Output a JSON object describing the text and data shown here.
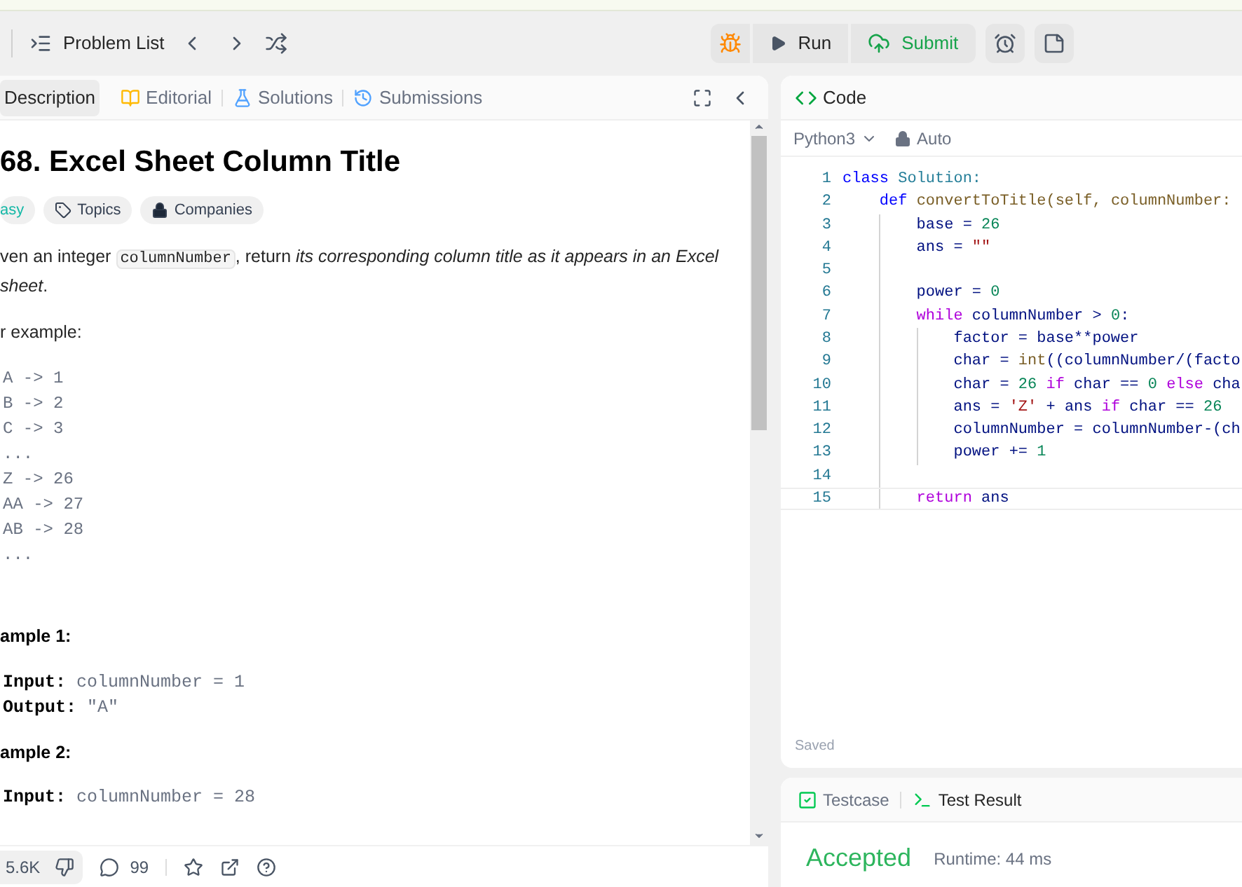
{
  "top_bar": {
    "problem_list": "Problem List",
    "run": "Run",
    "submit": "Submit"
  },
  "description_tabs": [
    {
      "label": "Description",
      "selected": true,
      "kind": "none"
    },
    {
      "label": "Editorial",
      "selected": false,
      "kind": "book"
    },
    {
      "label": "Solutions",
      "selected": false,
      "kind": "flask"
    },
    {
      "label": "Submissions",
      "selected": false,
      "kind": "history"
    }
  ],
  "problem": {
    "title": "68. Excel Sheet Column Title",
    "tags": [
      {
        "label": "asy",
        "kind": "difficulty"
      },
      {
        "label": "Topics",
        "kind": "tag"
      },
      {
        "label": "Companies",
        "kind": "lock"
      }
    ],
    "statement": {
      "before": "ven an integer ",
      "code": "columnNumber",
      "after": ", return *its corresponding column title as it appears in an Excel sheet*."
    },
    "intro": "r example:",
    "mapping": [
      "A -> 1",
      "B -> 2",
      "C -> 3",
      "...",
      "Z -> 26",
      "AA -> 27",
      "AB -> 28",
      "..."
    ],
    "examples": [
      {
        "heading": "ample 1:",
        "lines": [
          {
            "label": "Input:",
            "value": "columnNumber = 1"
          },
          {
            "label": "Output:",
            "value": "\"A\""
          }
        ]
      },
      {
        "heading": "ample 2:",
        "lines": [
          {
            "label": "Input:",
            "value": "columnNumber = 28"
          }
        ]
      }
    ]
  },
  "footer": {
    "likes": "5.6K",
    "comments": "99"
  },
  "code_panel": {
    "title": "Code",
    "language": "Python3",
    "mode": "Auto",
    "status": "Saved",
    "lines": [
      {
        "number": "1",
        "tokens": [
          {
            "t": "class",
            "kind": "keyword"
          },
          {
            "t": " Solution:",
            "kind": "classname"
          }
        ]
      },
      {
        "number": "2",
        "tokens": [
          {
            "t": "    def",
            "kind": "keyword"
          },
          {
            "t": " convertToTitle(self, columnNumber:",
            "kind": "function"
          }
        ]
      },
      {
        "number": "3",
        "tokens": [
          {
            "t": "        base = ",
            "kind": "identifier"
          },
          {
            "t": "26",
            "kind": "number"
          }
        ]
      },
      {
        "number": "4",
        "tokens": [
          {
            "t": "        ans = ",
            "kind": "identifier"
          },
          {
            "t": "\"\"",
            "kind": "string"
          }
        ]
      },
      {
        "number": "5"
      },
      {
        "number": "6",
        "tokens": [
          {
            "t": "        power = ",
            "kind": "identifier"
          },
          {
            "t": "0",
            "kind": "number"
          }
        ]
      },
      {
        "number": "7",
        "tokens": [
          {
            "t": "        while",
            "kind": "control"
          },
          {
            "t": " columnNumber > ",
            "kind": "identifier"
          },
          {
            "t": "0",
            "kind": "number"
          },
          {
            "t": ":",
            "kind": "identifier"
          }
        ]
      },
      {
        "number": "8",
        "tokens": [
          {
            "t": "            factor = base**power",
            "kind": "identifier"
          }
        ]
      },
      {
        "number": "9",
        "tokens": [
          {
            "t": "            char = ",
            "kind": "identifier"
          },
          {
            "t": "int",
            "kind": "function"
          },
          {
            "t": "((columnNumber/(facto",
            "kind": "identifier"
          }
        ]
      },
      {
        "number": "10",
        "tokens": [
          {
            "t": "            char = ",
            "kind": "identifier"
          },
          {
            "t": "26",
            "kind": "number"
          },
          {
            "t": " if",
            "kind": "control"
          },
          {
            "t": " char == ",
            "kind": "identifier"
          },
          {
            "t": "0",
            "kind": "number"
          },
          {
            "t": " else",
            "kind": "control"
          },
          {
            "t": " cha",
            "kind": "identifier"
          }
        ]
      },
      {
        "number": "11",
        "tokens": [
          {
            "t": "            ans = ",
            "kind": "identifier"
          },
          {
            "t": "'Z'",
            "kind": "string"
          },
          {
            "t": " + ans ",
            "kind": "identifier"
          },
          {
            "t": "if",
            "kind": "control"
          },
          {
            "t": " char == ",
            "kind": "identifier"
          },
          {
            "t": "26",
            "kind": "number"
          }
        ]
      },
      {
        "number": "12",
        "tokens": [
          {
            "t": "            columnNumber = columnNumber-(ch",
            "kind": "identifier"
          }
        ]
      },
      {
        "number": "13",
        "tokens": [
          {
            "t": "            power += ",
            "kind": "identifier"
          },
          {
            "t": "1",
            "kind": "number"
          }
        ]
      },
      {
        "number": "14"
      },
      {
        "number": "15",
        "tokens": [
          {
            "t": "        return",
            "kind": "control"
          },
          {
            "t": " ans",
            "kind": "identifier"
          }
        ]
      }
    ]
  },
  "result_tabs": [
    {
      "label": "Testcase",
      "selected": false,
      "kind": "check"
    },
    {
      "label": "Test Result",
      "selected": true,
      "kind": "terminal"
    }
  ],
  "result": {
    "verdict": "Accepted",
    "runtime": "Runtime: 44 ms"
  }
}
